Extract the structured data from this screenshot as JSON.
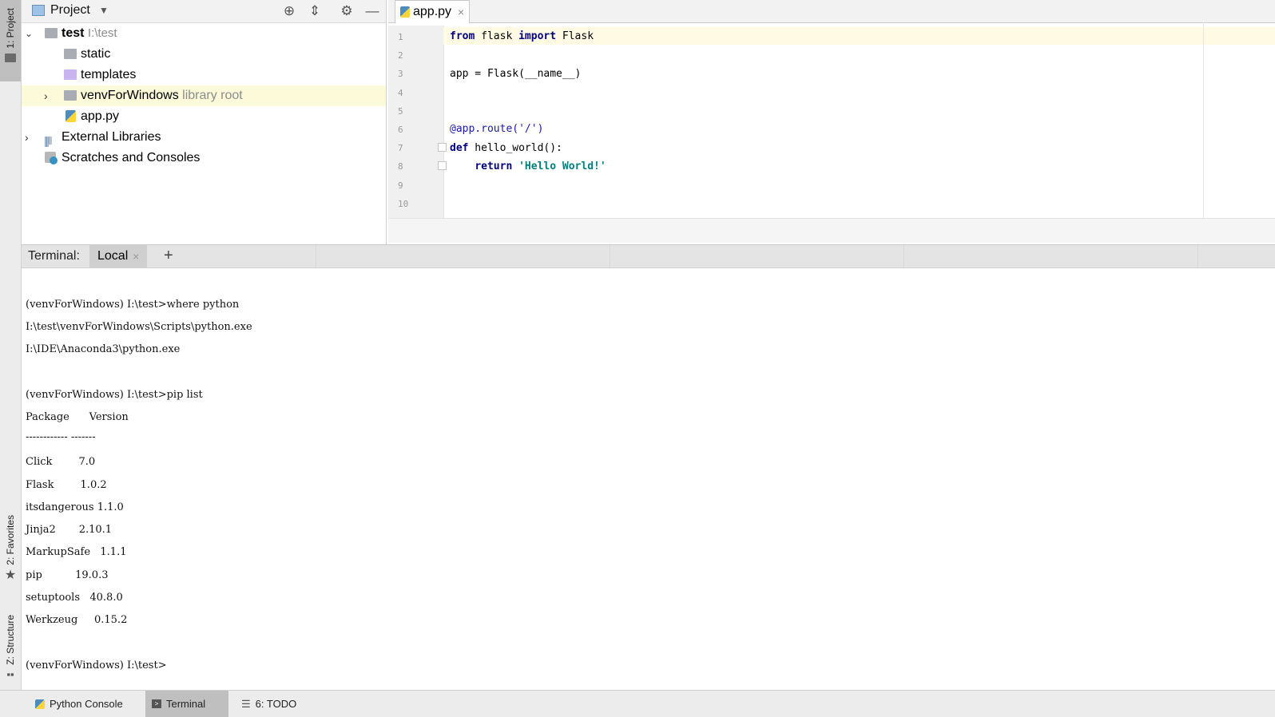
{
  "sidebar": {
    "project_label": "1: Project",
    "favorites_label": "2: Favorites",
    "structure_label": "Z: Structure"
  },
  "project_panel": {
    "title": "Project",
    "tree": [
      {
        "name": "test",
        "hint": "I:\\test"
      },
      {
        "name": "static"
      },
      {
        "name": "templates"
      },
      {
        "name": "venvForWindows",
        "hint": "library root"
      },
      {
        "name": "app.py"
      },
      {
        "name": "External Libraries"
      },
      {
        "name": "Scratches and Consoles"
      }
    ]
  },
  "editor": {
    "tab": "app.py",
    "line_numbers": [
      "1",
      "2",
      "3",
      "4",
      "5",
      "6",
      "7",
      "8",
      "9",
      "10"
    ],
    "code": {
      "l1_kw1": "from",
      "l1_mod": " flask ",
      "l1_kw2": "import",
      "l1_name": " Flask",
      "l3": "app = Flask(__name__)",
      "l6": "@app.route('/')",
      "l7_kw": "def",
      "l7_rest": " hello_world():",
      "l8_kw": "return",
      "l8_str": " 'Hello World!'"
    }
  },
  "terminal": {
    "label": "Terminal:",
    "tab": "Local",
    "lines": [
      "(venvForWindows) I:\\test>where python",
      "I:\\test\\venvForWindows\\Scripts\\python.exe",
      "I:\\IDE\\Anaconda3\\python.exe",
      "",
      "(venvForWindows) I:\\test>pip list",
      "Package      Version",
      "------------ -------",
      "Click        7.0",
      "Flask        1.0.2",
      "itsdangerous 1.1.0",
      "Jinja2       2.10.1",
      "MarkupSafe   1.1.1",
      "pip          19.0.3",
      "setuptools   40.8.0",
      "Werkzeug     0.15.2",
      "",
      "(venvForWindows) I:\\test>"
    ]
  },
  "bottom_bar": {
    "python_console": "Python Console",
    "terminal": "Terminal",
    "todo": "6: TODO"
  },
  "colors": {
    "selection": "#fcfad9",
    "current_line": "#fffae3",
    "keyword": "#000080",
    "string": "#008080"
  }
}
